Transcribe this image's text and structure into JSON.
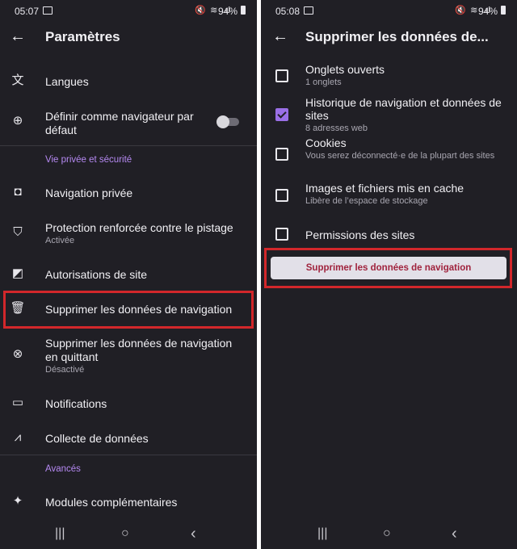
{
  "left": {
    "status": {
      "time": "05:07",
      "battery": "94%",
      "signal_icons": "🔇 ≋ .ıl"
    },
    "title": "Paramètres",
    "items": [
      {
        "icon": "translate-icon",
        "label": "Langues"
      },
      {
        "icon": "globe-icon",
        "label": "Définir comme navigateur par défaut"
      },
      {
        "section": "Vie privée et sécurité"
      },
      {
        "icon": "mask-icon",
        "label": "Navigation privée"
      },
      {
        "icon": "shield-icon",
        "label": "Protection renforcée contre le pistage",
        "sub": "Activée"
      },
      {
        "icon": "site-permissions-icon",
        "label": "Autorisations de site"
      },
      {
        "icon": "trash-icon",
        "label": "Supprimer les données de navigation"
      },
      {
        "icon": "close-circle-icon",
        "label": "Supprimer les données de navigation en quittant",
        "sub": "Désactivé"
      },
      {
        "icon": "message-icon",
        "label": "Notifications"
      },
      {
        "icon": "chart-line-icon",
        "label": "Collecte de données"
      },
      {
        "section": "Avancés"
      },
      {
        "icon": "puzzle-icon",
        "label": "Modules complémentaires"
      }
    ],
    "default_browser_toggle": false
  },
  "right": {
    "status": {
      "time": "05:08",
      "battery": "94%",
      "signal_icons": "🔇 ≋ .ıl"
    },
    "title": "Supprimer les données de...",
    "options": [
      {
        "label": "Onglets ouverts",
        "sub": "1 onglets",
        "checked": false
      },
      {
        "label": "Historique de navigation et données de sites",
        "sub": "8 adresses web",
        "checked": true
      },
      {
        "label": "Cookies",
        "sub": "Vous serez déconnecté·e de la plupart des sites",
        "checked": false
      },
      {
        "label": "Images et fichiers mis en cache",
        "sub": "Libère de l’espace de stockage",
        "checked": false
      },
      {
        "label": "Permissions des sites",
        "sub": "",
        "checked": false
      }
    ],
    "button": "Supprimer les données de navigation"
  },
  "nav": {
    "recents": "|||",
    "home": "○",
    "back": "‹"
  },
  "colors": {
    "background": "#201f25",
    "accent": "#b589f2",
    "highlight": "#d2272b",
    "button_text": "#a0233d"
  }
}
